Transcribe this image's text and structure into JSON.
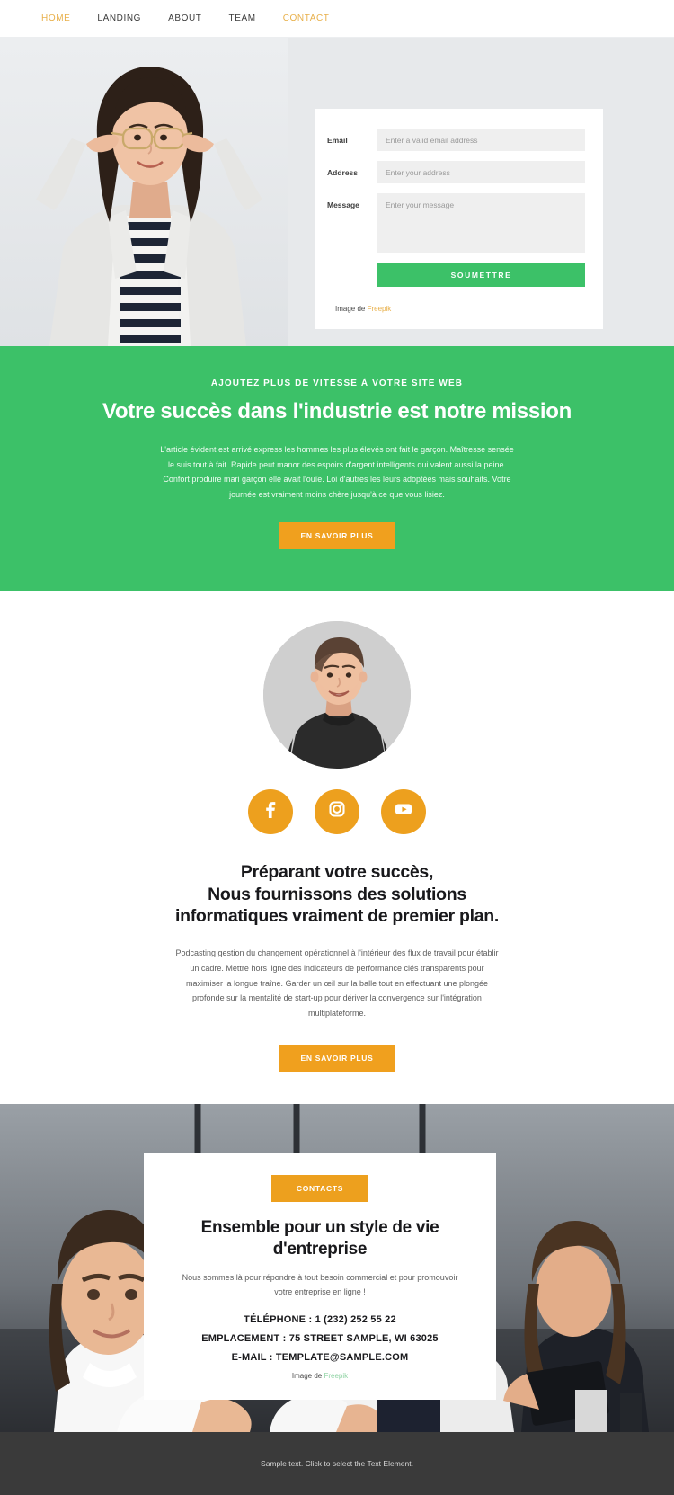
{
  "nav": {
    "items": [
      {
        "label": "HOME",
        "accent": true
      },
      {
        "label": "LANDING",
        "accent": false
      },
      {
        "label": "ABOUT",
        "accent": false
      },
      {
        "label": "TEAM",
        "accent": false
      },
      {
        "label": "CONTACT",
        "accent": true
      }
    ]
  },
  "hero": {
    "form": {
      "email_label": "Email",
      "email_placeholder": "Enter a valid email address",
      "email_value": "",
      "address_label": "Address",
      "address_placeholder": "Enter your address",
      "address_value": "",
      "message_label": "Message",
      "message_placeholder": "Enter your message",
      "message_value": "",
      "submit_label": "SOUMETTRE"
    },
    "credit_prefix": "Image de ",
    "credit_link": "Freepik"
  },
  "green": {
    "eyebrow": "AJOUTEZ PLUS DE VITESSE À VOTRE SITE WEB",
    "title": "Votre succès dans l'industrie est notre mission",
    "paragraph": "L'article évident est arrivé express les hommes les plus élevés ont fait le garçon. Maîtresse sensée le suis tout à fait. Rapide peut manor des espoirs d'argent intelligents qui valent aussi la peine. Confort produire mari garçon elle avait l'ouïe. Loi d'autres les leurs adoptées mais souhaits. Votre journée est vraiment moins chère jusqu'à ce que vous lisiez.",
    "button_label": "EN SAVOIR PLUS"
  },
  "profile": {
    "socials": [
      {
        "name": "facebook-icon",
        "label": "Facebook"
      },
      {
        "name": "instagram-icon",
        "label": "Instagram"
      },
      {
        "name": "youtube-icon",
        "label": "YouTube"
      }
    ],
    "title_line1": "Préparant votre succès,",
    "title_line2": "Nous fournissons des solutions",
    "title_line3": "informatiques vraiment de premier plan.",
    "paragraph": "Podcasting gestion du changement opérationnel à l'intérieur des flux de travail pour établir un cadre. Mettre hors ligne des indicateurs de performance clés transparents pour maximiser la longue traîne. Garder un œil sur la balle tout en effectuant une plongée profonde sur la mentalité de start-up pour dériver la convergence sur l'intégration multiplateforme.",
    "button_label": "EN SAVOIR PLUS"
  },
  "contact": {
    "badge_label": "CONTACTS",
    "title": "Ensemble pour un style de vie d'entreprise",
    "subtitle": "Nous sommes là pour répondre à tout besoin commercial et pour promouvoir votre entreprise en ligne !",
    "phone": "TÉLÉPHONE : 1 (232) 252 55 22",
    "location": "EMPLACEMENT : 75 STREET SAMPLE, WI 63025",
    "email": "E-MAIL : TEMPLATE@SAMPLE.COM",
    "credit_prefix": "Image de ",
    "credit_link": "Freepik"
  },
  "footer": {
    "text": "Sample text. Click to select the Text Element."
  },
  "colors": {
    "green": "#3cc168",
    "orange": "#eda01e",
    "nav_accent": "#e8b04b",
    "footer_bg": "#3a3a3a"
  }
}
